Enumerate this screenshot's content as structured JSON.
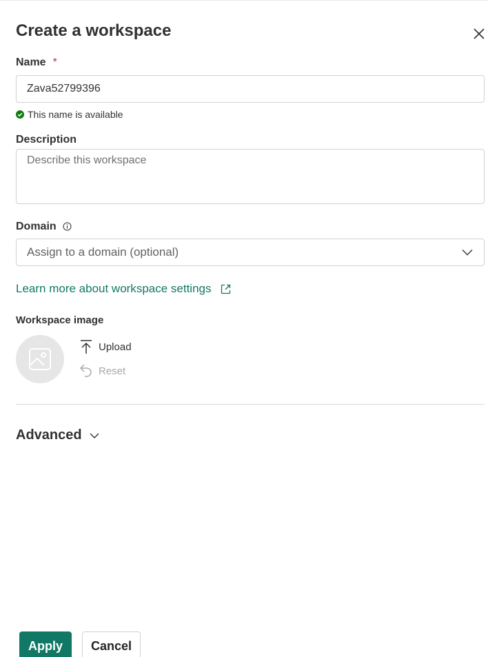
{
  "dialog": {
    "title": "Create a workspace"
  },
  "name": {
    "label": "Name",
    "required_mark": "*",
    "value": "Zava52799396",
    "status": "This name is available"
  },
  "description": {
    "label": "Description",
    "placeholder": "Describe this workspace"
  },
  "domain": {
    "label": "Domain",
    "placeholder": "Assign to a domain (optional)"
  },
  "learn_more": {
    "label": "Learn more about workspace settings"
  },
  "workspace_image": {
    "label": "Workspace image",
    "upload_label": "Upload",
    "reset_label": "Reset"
  },
  "advanced": {
    "label": "Advanced"
  },
  "footer": {
    "apply_label": "Apply",
    "cancel_label": "Cancel"
  },
  "colors": {
    "accent": "#117865",
    "success": "#107c10",
    "required": "#c4314b"
  },
  "icons": {
    "close": "close-icon",
    "check": "check-circle-icon",
    "info": "info-icon",
    "chevron": "chevron-down-icon",
    "external": "open-external-icon",
    "image": "image-placeholder-icon",
    "upload": "upload-icon",
    "reset": "undo-icon"
  }
}
